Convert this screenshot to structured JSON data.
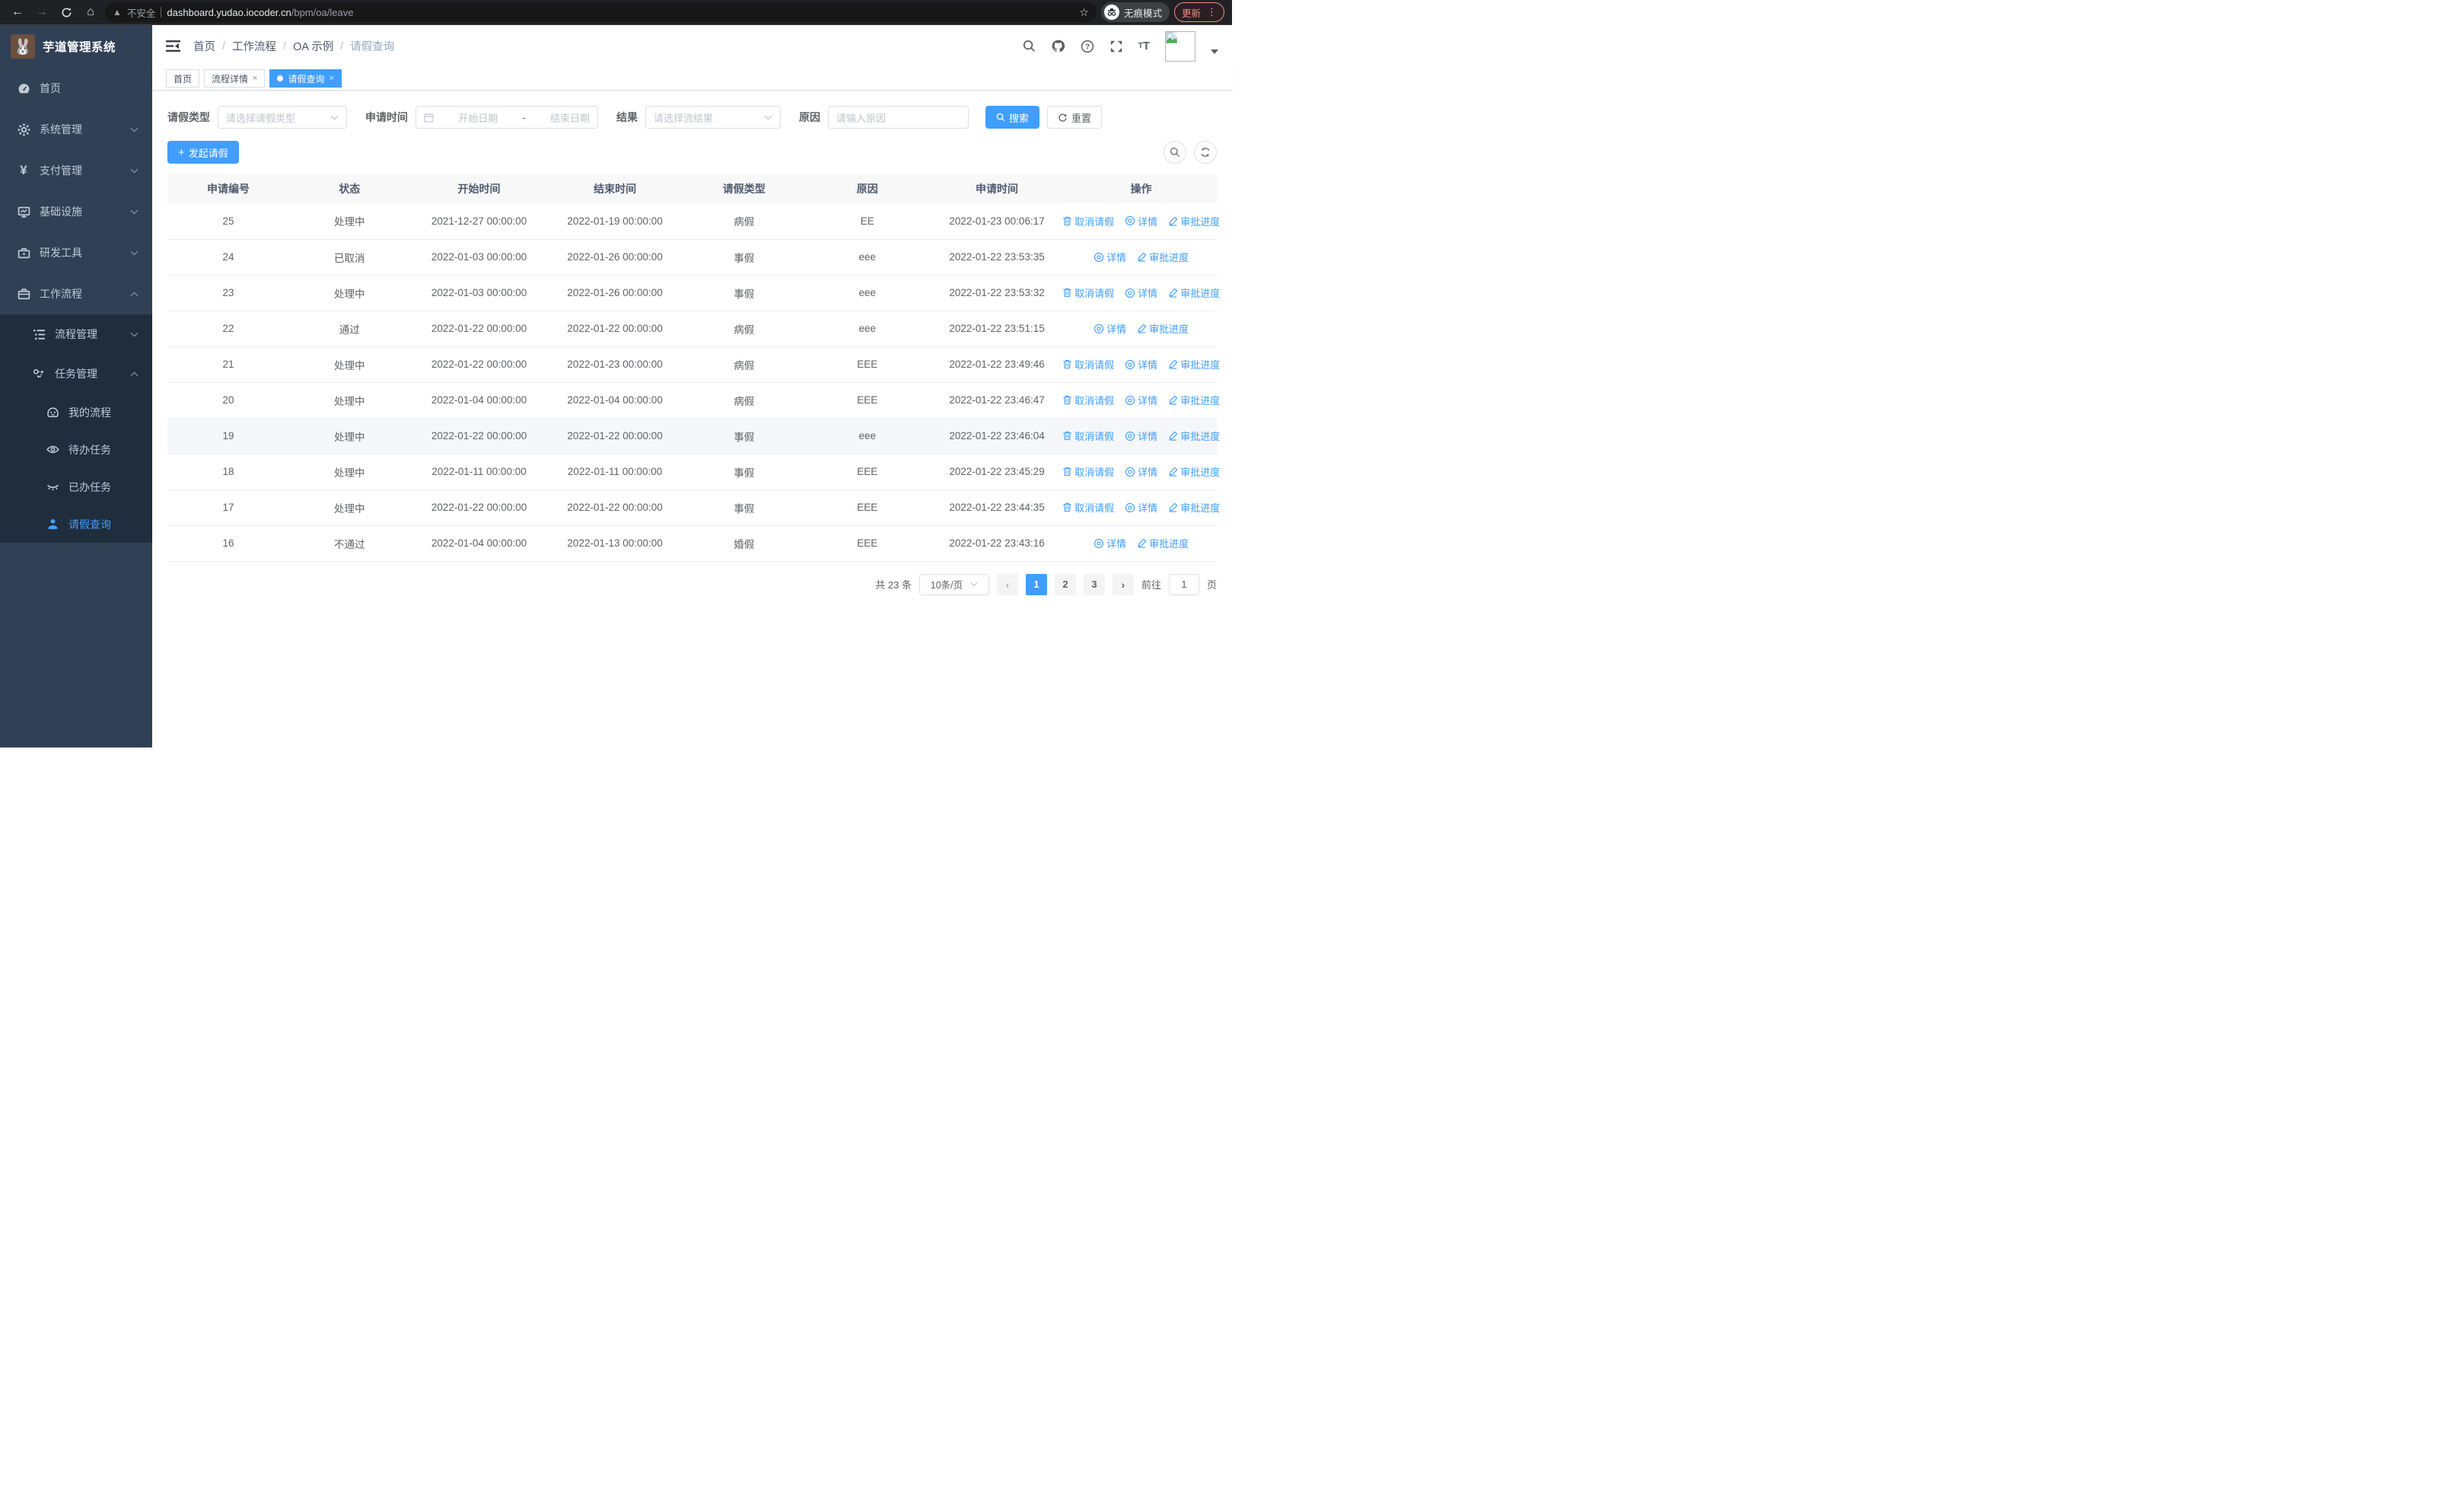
{
  "browser": {
    "not_secure": "不安全",
    "url_host": "dashboard.yudao.iocoder.cn",
    "url_path": "/bpm/oa/leave",
    "incognito_label": "无痕模式",
    "update_label": "更新"
  },
  "sidebar": {
    "logo_title": "芋道管理系统",
    "items": [
      {
        "label": "首页",
        "icon": "dashboard-icon",
        "level": 1
      },
      {
        "label": "系统管理",
        "icon": "gear-icon",
        "level": 1,
        "arrow": "down"
      },
      {
        "label": "支付管理",
        "icon": "yen-icon",
        "level": 1,
        "arrow": "down"
      },
      {
        "label": "基础设施",
        "icon": "monitor-icon",
        "level": 1,
        "arrow": "down"
      },
      {
        "label": "研发工具",
        "icon": "toolbox-icon",
        "level": 1,
        "arrow": "down"
      },
      {
        "label": "工作流程",
        "icon": "briefcase-icon",
        "level": 1,
        "arrow": "up"
      },
      {
        "label": "流程管理",
        "icon": "list-icon",
        "level": 2,
        "arrow": "down",
        "dark": true
      },
      {
        "label": "任务管理",
        "icon": "flow-icon",
        "level": 2,
        "arrow": "up",
        "dark": true
      },
      {
        "label": "我的流程",
        "icon": "face-icon",
        "level": 3,
        "dark": true
      },
      {
        "label": "待办任务",
        "icon": "eye-open-icon",
        "level": 3,
        "dark": true
      },
      {
        "label": "已办任务",
        "icon": "eye-closed-icon",
        "level": 3,
        "dark": true
      },
      {
        "label": "请假查询",
        "icon": "user-icon",
        "level": 3,
        "dark": true,
        "active": true
      }
    ]
  },
  "header": {
    "breadcrumb": [
      "首页",
      "工作流程",
      "OA 示例",
      "请假查询"
    ]
  },
  "tabs": [
    {
      "label": "首页",
      "closable": false,
      "active": false
    },
    {
      "label": "流程详情",
      "closable": true,
      "active": false
    },
    {
      "label": "请假查询",
      "closable": true,
      "active": true
    }
  ],
  "filters": {
    "leave_type": {
      "label": "请假类型",
      "placeholder": "请选择请假类型"
    },
    "apply_time": {
      "label": "申请时间",
      "start_placeholder": "开始日期",
      "separator": "-",
      "end_placeholder": "结束日期"
    },
    "result": {
      "label": "结果",
      "placeholder": "请选择流结果"
    },
    "reason": {
      "label": "原因",
      "placeholder": "请输入原因"
    },
    "search_label": "搜索",
    "reset_label": "重置"
  },
  "toolbar": {
    "create_label": "发起请假"
  },
  "table": {
    "columns": [
      "申请编号",
      "状态",
      "开始时间",
      "结束时间",
      "请假类型",
      "原因",
      "申请时间",
      "操作"
    ],
    "action_labels": {
      "cancel": "取消请假",
      "detail": "详情",
      "progress": "审批进度"
    },
    "rows": [
      {
        "id": "25",
        "status": "处理中",
        "start": "2021-12-27 00:00:00",
        "end": "2022-01-19 00:00:00",
        "type": "病假",
        "reason": "EE",
        "apply": "2022-01-23 00:06:17",
        "actions": [
          "cancel",
          "detail",
          "progress"
        ],
        "highlight": false
      },
      {
        "id": "24",
        "status": "已取消",
        "start": "2022-01-03 00:00:00",
        "end": "2022-01-26 00:00:00",
        "type": "事假",
        "reason": "eee",
        "apply": "2022-01-22 23:53:35",
        "actions": [
          "detail",
          "progress"
        ],
        "highlight": false
      },
      {
        "id": "23",
        "status": "处理中",
        "start": "2022-01-03 00:00:00",
        "end": "2022-01-26 00:00:00",
        "type": "事假",
        "reason": "eee",
        "apply": "2022-01-22 23:53:32",
        "actions": [
          "cancel",
          "detail",
          "progress"
        ],
        "highlight": false
      },
      {
        "id": "22",
        "status": "通过",
        "start": "2022-01-22 00:00:00",
        "end": "2022-01-22 00:00:00",
        "type": "病假",
        "reason": "eee",
        "apply": "2022-01-22 23:51:15",
        "actions": [
          "detail",
          "progress"
        ],
        "highlight": false
      },
      {
        "id": "21",
        "status": "处理中",
        "start": "2022-01-22 00:00:00",
        "end": "2022-01-23 00:00:00",
        "type": "病假",
        "reason": "EEE",
        "apply": "2022-01-22 23:49:46",
        "actions": [
          "cancel",
          "detail",
          "progress"
        ],
        "highlight": false
      },
      {
        "id": "20",
        "status": "处理中",
        "start": "2022-01-04 00:00:00",
        "end": "2022-01-04 00:00:00",
        "type": "病假",
        "reason": "EEE",
        "apply": "2022-01-22 23:46:47",
        "actions": [
          "cancel",
          "detail",
          "progress"
        ],
        "highlight": false
      },
      {
        "id": "19",
        "status": "处理中",
        "start": "2022-01-22 00:00:00",
        "end": "2022-01-22 00:00:00",
        "type": "事假",
        "reason": "eee",
        "apply": "2022-01-22 23:46:04",
        "actions": [
          "cancel",
          "detail",
          "progress"
        ],
        "highlight": true
      },
      {
        "id": "18",
        "status": "处理中",
        "start": "2022-01-11 00:00:00",
        "end": "2022-01-11 00:00:00",
        "type": "事假",
        "reason": "EEE",
        "apply": "2022-01-22 23:45:29",
        "actions": [
          "cancel",
          "detail",
          "progress"
        ],
        "highlight": false
      },
      {
        "id": "17",
        "status": "处理中",
        "start": "2022-01-22 00:00:00",
        "end": "2022-01-22 00:00:00",
        "type": "事假",
        "reason": "EEE",
        "apply": "2022-01-22 23:44:35",
        "actions": [
          "cancel",
          "detail",
          "progress"
        ],
        "highlight": false
      },
      {
        "id": "16",
        "status": "不通过",
        "start": "2022-01-04 00:00:00",
        "end": "2022-01-13 00:00:00",
        "type": "婚假",
        "reason": "EEE",
        "apply": "2022-01-22 23:43:16",
        "actions": [
          "detail",
          "progress"
        ],
        "highlight": false
      }
    ]
  },
  "pagination": {
    "total_text": "共 23 条",
    "page_size": "10条/页",
    "pages": [
      "1",
      "2",
      "3"
    ],
    "current": "1",
    "jump_prefix": "前往",
    "jump_value": "1",
    "jump_suffix": "页"
  },
  "colors": {
    "primary": "#409eff",
    "sidebar_bg": "#304156",
    "submenu_bg": "#1f2d3d"
  }
}
